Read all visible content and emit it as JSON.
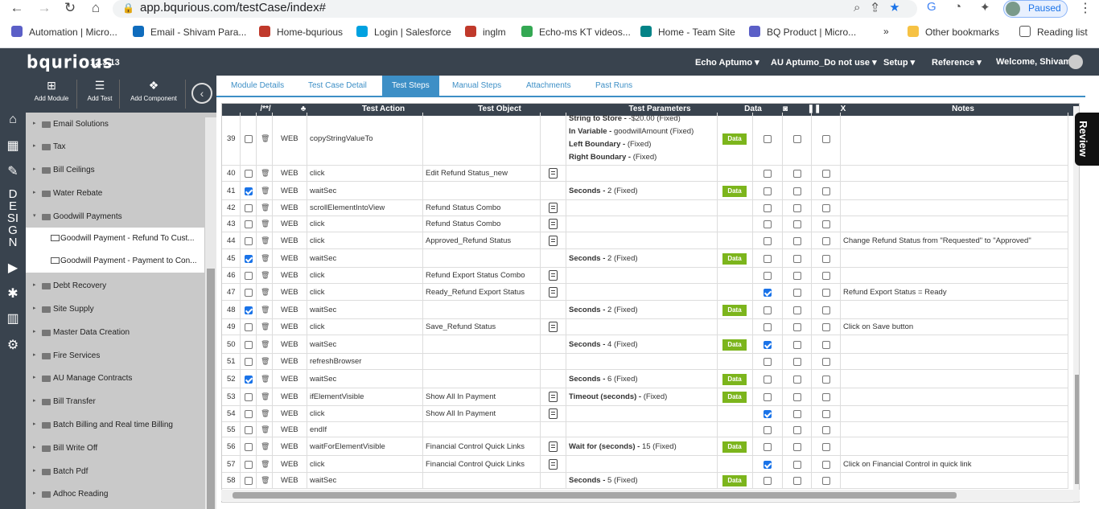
{
  "browser": {
    "url": "app.bqurious.com/testCase/index#",
    "paused_label": "Paused",
    "bookmarks": [
      {
        "label": "Automation | Micro...",
        "icon": "teams-icon",
        "color": "#5b5fc7"
      },
      {
        "label": "Email - Shivam Para...",
        "icon": "outlook-icon",
        "color": "#0f6cbd"
      },
      {
        "label": "Home-bqurious",
        "icon": "bq-icon",
        "color": "#c0392b"
      },
      {
        "label": "Login | Salesforce",
        "icon": "salesforce-icon",
        "color": "#00a1e0"
      },
      {
        "label": "inglm",
        "icon": "bq-icon",
        "color": "#c0392b"
      },
      {
        "label": "Echo-ms KT videos...",
        "icon": "drive-icon",
        "color": "#34a853"
      },
      {
        "label": "Home - Team Site",
        "icon": "sharepoint-icon",
        "color": "#038387"
      },
      {
        "label": "BQ Product | Micro...",
        "icon": "teams-icon",
        "color": "#5b5fc7"
      }
    ],
    "more_label": "»",
    "other_bookmarks": "Other bookmarks",
    "reading_list": "Reading list"
  },
  "app": {
    "logo": "bqurious",
    "version": "12.3.13",
    "menus": [
      "Echo Aptumo",
      "AU Aptumo_Do not use",
      "Setup",
      "Reference"
    ],
    "welcome": "Welcome, Shivam",
    "design_letters": [
      "D",
      "E",
      "SI",
      "G",
      "N"
    ]
  },
  "toolbar": {
    "add_module": "Add Module",
    "add_test": "Add Test",
    "add_component": "Add Component"
  },
  "tree": [
    {
      "label": "Email Solutions",
      "child": false
    },
    {
      "label": "Tax",
      "child": false
    },
    {
      "label": "Bill Ceilings",
      "child": false
    },
    {
      "label": "Water Rebate",
      "child": false
    },
    {
      "label": "Goodwill Payments",
      "child": false,
      "expanded": true
    },
    {
      "label": "Goodwill Payment - Refund To Cust...",
      "child": true
    },
    {
      "label": "Goodwill Payment - Payment to Con...",
      "child": true
    },
    {
      "label": "Debt Recovery",
      "child": false
    },
    {
      "label": "Site Supply",
      "child": false
    },
    {
      "label": "Master Data Creation",
      "child": false
    },
    {
      "label": "Fire Services",
      "child": false
    },
    {
      "label": "AU Manage Contracts",
      "child": false
    },
    {
      "label": "Bill Transfer",
      "child": false
    },
    {
      "label": "Batch Billing and Real time Billing",
      "child": false
    },
    {
      "label": "Bill Write Off",
      "child": false
    },
    {
      "label": "Batch Pdf",
      "child": false
    },
    {
      "label": "Adhoc Reading",
      "child": false
    }
  ],
  "tabs": [
    "Module Details",
    "Test Case Detail",
    "Test Steps",
    "Manual Steps",
    "Attachments",
    "Past Runs"
  ],
  "active_tab": "Test Steps",
  "grid": {
    "headers": {
      "comment": "/**/",
      "action": "Test Action",
      "object": "Test Object",
      "params": "Test Parameters",
      "data": "Data",
      "x": "X",
      "notes": "Notes"
    },
    "data_button": "Data",
    "rows": [
      {
        "n": "39",
        "chk": false,
        "type": "WEB",
        "action": "copyStringValueTo",
        "object": "",
        "objicon": false,
        "params": [
          [
            "String to Store - ",
            "-$20.00 (Fixed)"
          ],
          [
            "In Variable - ",
            "goodwillAmount (Fixed)"
          ],
          [
            "Left Boundary - ",
            " (Fixed)"
          ],
          [
            "Right Boundary - ",
            " (Fixed)"
          ]
        ],
        "data": true,
        "snap": false,
        "notes": ""
      },
      {
        "n": "40",
        "chk": false,
        "type": "WEB",
        "action": "click",
        "object": "Edit Refund Status_new",
        "objicon": true,
        "params": [],
        "data": false,
        "snap": false,
        "notes": ""
      },
      {
        "n": "41",
        "chk": true,
        "type": "WEB",
        "action": "waitSec",
        "object": "",
        "objicon": false,
        "params": [
          [
            "Seconds - ",
            "2 (Fixed)"
          ]
        ],
        "data": true,
        "snap": false,
        "notes": ""
      },
      {
        "n": "42",
        "chk": false,
        "type": "WEB",
        "action": "scrollElementIntoView",
        "object": "Refund Status Combo",
        "objicon": true,
        "params": [],
        "data": false,
        "snap": false,
        "notes": ""
      },
      {
        "n": "43",
        "chk": false,
        "type": "WEB",
        "action": "click",
        "object": "Refund Status Combo",
        "objicon": true,
        "params": [],
        "data": false,
        "snap": false,
        "notes": ""
      },
      {
        "n": "44",
        "chk": false,
        "type": "WEB",
        "action": "click",
        "object": "Approved_Refund Status",
        "objicon": true,
        "params": [],
        "data": false,
        "snap": false,
        "notes": "Change Refund Status from \"Requested\" to \"Approved\""
      },
      {
        "n": "45",
        "chk": true,
        "type": "WEB",
        "action": "waitSec",
        "object": "",
        "objicon": false,
        "params": [
          [
            "Seconds - ",
            "2 (Fixed)"
          ]
        ],
        "data": true,
        "snap": false,
        "notes": ""
      },
      {
        "n": "46",
        "chk": false,
        "type": "WEB",
        "action": "click",
        "object": "Refund Export Status Combo",
        "objicon": true,
        "params": [],
        "data": false,
        "snap": false,
        "notes": ""
      },
      {
        "n": "47",
        "chk": false,
        "type": "WEB",
        "action": "click",
        "object": "Ready_Refund Export Status",
        "objicon": true,
        "params": [],
        "data": false,
        "snap": true,
        "notes": "Refund Export Status = Ready"
      },
      {
        "n": "48",
        "chk": true,
        "type": "WEB",
        "action": "waitSec",
        "object": "",
        "objicon": false,
        "params": [
          [
            "Seconds - ",
            "2 (Fixed)"
          ]
        ],
        "data": true,
        "snap": false,
        "notes": ""
      },
      {
        "n": "49",
        "chk": false,
        "type": "WEB",
        "action": "click",
        "object": "Save_Refund Status",
        "objicon": true,
        "params": [],
        "data": false,
        "snap": false,
        "notes": "Click on Save button"
      },
      {
        "n": "50",
        "chk": false,
        "type": "WEB",
        "action": "waitSec",
        "object": "",
        "objicon": false,
        "params": [
          [
            "Seconds - ",
            "4 (Fixed)"
          ]
        ],
        "data": true,
        "snap": true,
        "notes": ""
      },
      {
        "n": "51",
        "chk": false,
        "type": "WEB",
        "action": "refreshBrowser",
        "object": "",
        "objicon": false,
        "params": [],
        "data": false,
        "snap": false,
        "notes": ""
      },
      {
        "n": "52",
        "chk": true,
        "type": "WEB",
        "action": "waitSec",
        "object": "",
        "objicon": false,
        "params": [
          [
            "Seconds - ",
            "6 (Fixed)"
          ]
        ],
        "data": true,
        "snap": false,
        "notes": ""
      },
      {
        "n": "53",
        "chk": false,
        "type": "WEB",
        "action": "ifElementVisible",
        "object": "Show All In Payment",
        "objicon": true,
        "params": [
          [
            "Timeout (seconds) - ",
            " (Fixed)"
          ]
        ],
        "data": true,
        "snap": false,
        "notes": ""
      },
      {
        "n": "54",
        "chk": false,
        "type": "WEB",
        "action": "click",
        "object": "Show All In Payment",
        "objicon": true,
        "params": [],
        "data": false,
        "snap": true,
        "notes": ""
      },
      {
        "n": "55",
        "chk": false,
        "type": "WEB",
        "action": "endIf",
        "object": "",
        "objicon": false,
        "params": [],
        "data": false,
        "snap": false,
        "notes": ""
      },
      {
        "n": "56",
        "chk": false,
        "type": "WEB",
        "action": "waitForElementVisible",
        "object": "Financial Control Quick Links",
        "objicon": true,
        "params": [
          [
            "Wait for (seconds) - ",
            "15 (Fixed)"
          ]
        ],
        "data": true,
        "snap": false,
        "notes": ""
      },
      {
        "n": "57",
        "chk": false,
        "type": "WEB",
        "action": "click",
        "object": "Financial Control Quick Links",
        "objicon": true,
        "params": [],
        "data": false,
        "snap": true,
        "notes": "Click on Financial Control in quick link"
      },
      {
        "n": "58",
        "chk": false,
        "type": "WEB",
        "action": "waitSec",
        "object": "",
        "objicon": false,
        "params": [
          [
            "Seconds - ",
            "5 (Fixed)"
          ]
        ],
        "data": true,
        "snap": false,
        "notes": ""
      }
    ]
  },
  "review_label": "Review"
}
